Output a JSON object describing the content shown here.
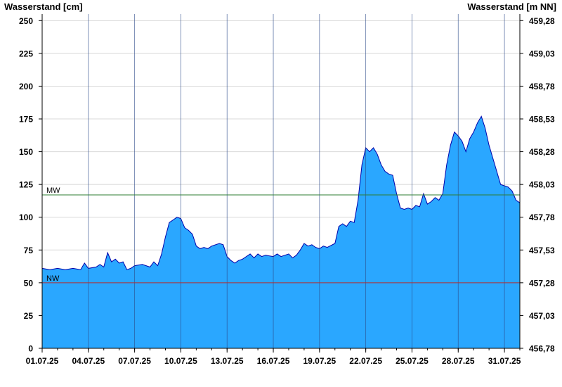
{
  "chart_data": {
    "type": "area",
    "ylabel_left": "Wasserstand [cm]",
    "ylabel_right": "Wasserstand [m NN]",
    "ylim": [
      0,
      255
    ],
    "yticks_left": [
      0,
      25,
      50,
      75,
      100,
      125,
      150,
      175,
      200,
      225,
      250
    ],
    "yticks_right": [
      "456,78",
      "457,03",
      "457,28",
      "457,53",
      "457,78",
      "458,03",
      "458,28",
      "458,53",
      "458,78",
      "459,03",
      "459,28"
    ],
    "xlim": [
      "2025-07-01",
      "2025-08-01"
    ],
    "xticks": [
      {
        "date": "2025-07-01",
        "label": "01.07.25"
      },
      {
        "date": "2025-07-04",
        "label": "04.07.25"
      },
      {
        "date": "2025-07-07",
        "label": "07.07.25"
      },
      {
        "date": "2025-07-10",
        "label": "10.07.25"
      },
      {
        "date": "2025-07-13",
        "label": "13.07.25"
      },
      {
        "date": "2025-07-16",
        "label": "16.07.25"
      },
      {
        "date": "2025-07-19",
        "label": "19.07.25"
      },
      {
        "date": "2025-07-22",
        "label": "22.07.25"
      },
      {
        "date": "2025-07-25",
        "label": "25.07.25"
      },
      {
        "date": "2025-07-28",
        "label": "28.07.25"
      },
      {
        "date": "2025-07-31",
        "label": "31.07.25"
      }
    ],
    "reference_lines": [
      {
        "label": "MW",
        "value": 117,
        "color": "#2e7d32"
      },
      {
        "label": "NW",
        "value": 50,
        "color": "#b03030"
      }
    ],
    "series": [
      {
        "fill_color": "#2aa7ff",
        "line_color": "#0000aa",
        "points": [
          [
            "2025-07-01 00:00",
            61
          ],
          [
            "2025-07-01 12:00",
            60
          ],
          [
            "2025-07-02 00:00",
            61
          ],
          [
            "2025-07-02 12:00",
            60
          ],
          [
            "2025-07-03 00:00",
            61
          ],
          [
            "2025-07-03 12:00",
            60
          ],
          [
            "2025-07-03 18:00",
            65
          ],
          [
            "2025-07-04 00:00",
            61
          ],
          [
            "2025-07-04 12:00",
            62
          ],
          [
            "2025-07-04 18:00",
            64
          ],
          [
            "2025-07-05 00:00",
            62
          ],
          [
            "2025-07-05 06:00",
            73
          ],
          [
            "2025-07-05 12:00",
            66
          ],
          [
            "2025-07-05 18:00",
            68
          ],
          [
            "2025-07-06 00:00",
            65
          ],
          [
            "2025-07-06 06:00",
            66
          ],
          [
            "2025-07-06 12:00",
            60
          ],
          [
            "2025-07-06 18:00",
            61
          ],
          [
            "2025-07-07 00:00",
            63
          ],
          [
            "2025-07-07 12:00",
            64
          ],
          [
            "2025-07-08 00:00",
            62
          ],
          [
            "2025-07-08 06:00",
            66
          ],
          [
            "2025-07-08 12:00",
            63
          ],
          [
            "2025-07-08 18:00",
            72
          ],
          [
            "2025-07-09 00:00",
            85
          ],
          [
            "2025-07-09 06:00",
            96
          ],
          [
            "2025-07-09 12:00",
            98
          ],
          [
            "2025-07-09 18:00",
            100
          ],
          [
            "2025-07-10 00:00",
            99
          ],
          [
            "2025-07-10 06:00",
            92
          ],
          [
            "2025-07-10 12:00",
            90
          ],
          [
            "2025-07-10 18:00",
            87
          ],
          [
            "2025-07-11 00:00",
            78
          ],
          [
            "2025-07-11 06:00",
            76
          ],
          [
            "2025-07-11 12:00",
            77
          ],
          [
            "2025-07-11 18:00",
            76
          ],
          [
            "2025-07-12 00:00",
            78
          ],
          [
            "2025-07-12 12:00",
            80
          ],
          [
            "2025-07-12 18:00",
            79
          ],
          [
            "2025-07-13 00:00",
            70
          ],
          [
            "2025-07-13 06:00",
            67
          ],
          [
            "2025-07-13 12:00",
            65
          ],
          [
            "2025-07-13 18:00",
            67
          ],
          [
            "2025-07-14 00:00",
            68
          ],
          [
            "2025-07-14 06:00",
            70
          ],
          [
            "2025-07-14 12:00",
            72
          ],
          [
            "2025-07-14 18:00",
            69
          ],
          [
            "2025-07-15 00:00",
            72
          ],
          [
            "2025-07-15 06:00",
            70
          ],
          [
            "2025-07-15 12:00",
            71
          ],
          [
            "2025-07-16 00:00",
            70
          ],
          [
            "2025-07-16 06:00",
            72
          ],
          [
            "2025-07-16 12:00",
            70
          ],
          [
            "2025-07-17 00:00",
            72
          ],
          [
            "2025-07-17 06:00",
            69
          ],
          [
            "2025-07-17 12:00",
            71
          ],
          [
            "2025-07-17 18:00",
            75
          ],
          [
            "2025-07-18 00:00",
            80
          ],
          [
            "2025-07-18 06:00",
            78
          ],
          [
            "2025-07-18 12:00",
            79
          ],
          [
            "2025-07-18 18:00",
            77
          ],
          [
            "2025-07-19 00:00",
            76
          ],
          [
            "2025-07-19 06:00",
            78
          ],
          [
            "2025-07-19 12:00",
            77
          ],
          [
            "2025-07-20 00:00",
            80
          ],
          [
            "2025-07-20 06:00",
            93
          ],
          [
            "2025-07-20 12:00",
            95
          ],
          [
            "2025-07-20 18:00",
            93
          ],
          [
            "2025-07-21 00:00",
            97
          ],
          [
            "2025-07-21 06:00",
            96
          ],
          [
            "2025-07-21 12:00",
            113
          ],
          [
            "2025-07-21 18:00",
            140
          ],
          [
            "2025-07-22 00:00",
            153
          ],
          [
            "2025-07-22 06:00",
            150
          ],
          [
            "2025-07-22 12:00",
            153
          ],
          [
            "2025-07-22 18:00",
            148
          ],
          [
            "2025-07-23 00:00",
            140
          ],
          [
            "2025-07-23 06:00",
            135
          ],
          [
            "2025-07-23 12:00",
            133
          ],
          [
            "2025-07-23 18:00",
            132
          ],
          [
            "2025-07-24 00:00",
            118
          ],
          [
            "2025-07-24 06:00",
            107
          ],
          [
            "2025-07-24 12:00",
            106
          ],
          [
            "2025-07-24 18:00",
            107
          ],
          [
            "2025-07-25 00:00",
            106
          ],
          [
            "2025-07-25 06:00",
            109
          ],
          [
            "2025-07-25 12:00",
            108
          ],
          [
            "2025-07-25 18:00",
            118
          ],
          [
            "2025-07-26 00:00",
            110
          ],
          [
            "2025-07-26 06:00",
            112
          ],
          [
            "2025-07-26 12:00",
            115
          ],
          [
            "2025-07-26 18:00",
            113
          ],
          [
            "2025-07-27 00:00",
            118
          ],
          [
            "2025-07-27 06:00",
            140
          ],
          [
            "2025-07-27 12:00",
            155
          ],
          [
            "2025-07-27 18:00",
            165
          ],
          [
            "2025-07-28 00:00",
            162
          ],
          [
            "2025-07-28 06:00",
            158
          ],
          [
            "2025-07-28 12:00",
            150
          ],
          [
            "2025-07-28 18:00",
            160
          ],
          [
            "2025-07-29 00:00",
            165
          ],
          [
            "2025-07-29 06:00",
            172
          ],
          [
            "2025-07-29 12:00",
            177
          ],
          [
            "2025-07-29 18:00",
            168
          ],
          [
            "2025-07-30 00:00",
            155
          ],
          [
            "2025-07-30 06:00",
            145
          ],
          [
            "2025-07-30 12:00",
            135
          ],
          [
            "2025-07-30 18:00",
            125
          ],
          [
            "2025-07-31 00:00",
            124
          ],
          [
            "2025-07-31 06:00",
            123
          ],
          [
            "2025-07-31 12:00",
            120
          ],
          [
            "2025-07-31 18:00",
            113
          ],
          [
            "2025-08-01 00:00",
            111
          ]
        ]
      }
    ]
  }
}
